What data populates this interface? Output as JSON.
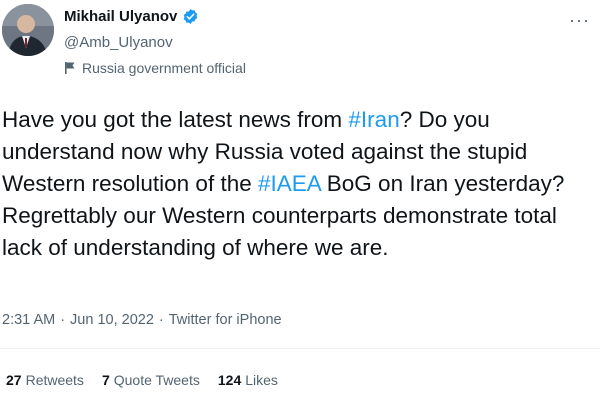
{
  "author": {
    "display_name": "Mikhail Ulyanov",
    "handle": "@Amb_Ulyanov",
    "label": "Russia government official",
    "verified": true
  },
  "tweet": {
    "segments": [
      {
        "text": "Have you got the latest news from ",
        "type": "text"
      },
      {
        "text": "#Iran",
        "type": "hashtag"
      },
      {
        "text": "? Do you understand now why Russia voted against the stupid Western resolution of the ",
        "type": "text"
      },
      {
        "text": "#IAEA",
        "type": "hashtag"
      },
      {
        "text": " BoG  on Iran yesterday? Regrettably our Western counterparts demonstrate total lack of understanding of where we are.",
        "type": "text"
      }
    ],
    "time": "2:31 AM",
    "date": "Jun 10, 2022",
    "source": "Twitter for iPhone",
    "separator": "·"
  },
  "stats": {
    "retweets_count": "27",
    "retweets_label": "Retweets",
    "quotes_count": "7",
    "quotes_label": "Quote Tweets",
    "likes_count": "124",
    "likes_label": "Likes"
  },
  "icons": {
    "verified": "verified-badge-icon",
    "label": "flag-icon",
    "more": "more-options-icon"
  },
  "colors": {
    "hashtag": "#1d9bf0",
    "secondary_text": "#536471",
    "primary_text": "#0f1419"
  }
}
